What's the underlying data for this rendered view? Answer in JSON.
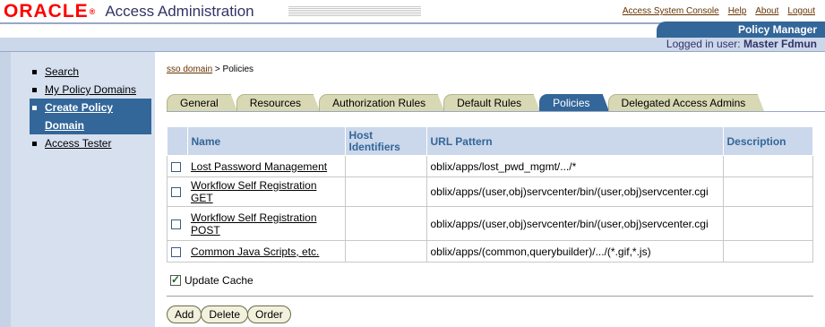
{
  "header": {
    "logo_text": "ORACLE",
    "logo_reg": "®",
    "app_title": "Access Administration",
    "links": [
      "Access System Console",
      "Help",
      "About",
      "Logout"
    ],
    "section_tab": "Policy Manager",
    "logged_in_label": "Logged in user:",
    "logged_in_user": "Master Fdmun"
  },
  "sidebar": {
    "items": [
      {
        "label": "Search",
        "active": false
      },
      {
        "label": "My Policy Domains",
        "active": false
      },
      {
        "label": "Create Policy Domain",
        "active": true
      },
      {
        "label": "Access Tester",
        "active": false
      }
    ]
  },
  "breadcrumb": {
    "parent": "sso domain",
    "separator": ">",
    "current": "Policies"
  },
  "tabs": [
    {
      "label": "General",
      "active": false
    },
    {
      "label": "Resources",
      "active": false
    },
    {
      "label": "Authorization Rules",
      "active": false
    },
    {
      "label": "Default Rules",
      "active": false
    },
    {
      "label": "Policies",
      "active": true
    },
    {
      "label": "Delegated Access Admins",
      "active": false
    }
  ],
  "table": {
    "headers": {
      "name": "Name",
      "host": "Host Identifiers",
      "url": "URL Pattern",
      "desc": "Description"
    },
    "rows": [
      {
        "name": "Lost Password Management",
        "host": "",
        "url": "oblix/apps/lost_pwd_mgmt/.../*",
        "desc": ""
      },
      {
        "name": "Workflow Self Registration GET",
        "host": "",
        "url": "oblix/apps/(user,obj)servcenter/bin/(user,obj)servcenter.cgi",
        "desc": ""
      },
      {
        "name": "Workflow Self Registration POST",
        "host": "",
        "url": "oblix/apps/(user,obj)servcenter/bin/(user,obj)servcenter.cgi",
        "desc": ""
      },
      {
        "name": "Common Java Scripts, etc.",
        "host": "",
        "url": "oblix/apps/(common,querybuilder)/.../(*.gif,*.js)",
        "desc": ""
      }
    ]
  },
  "update_cache": {
    "label": "Update Cache",
    "checked": true
  },
  "buttons": {
    "add": "Add",
    "delete": "Delete",
    "order": "Order"
  },
  "colors": {
    "oracle_red": "#ff0000",
    "accent_blue": "#336699",
    "tab_tan": "#d8d8b4",
    "header_blue": "#cbd7ea"
  }
}
